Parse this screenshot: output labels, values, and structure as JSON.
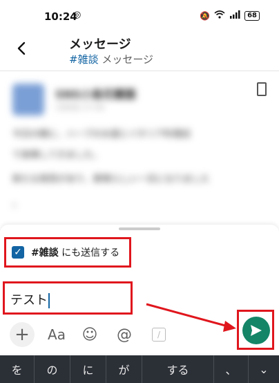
{
  "status_bar": {
    "time": "10:24",
    "battery": "68"
  },
  "header": {
    "title": "メッセージ",
    "channel": "#雑談",
    "subtitle_rest": " メッセージ"
  },
  "blurred_message": {
    "author": "SNS小島花蘭園",
    "date": "1月6日 17:44",
    "lines": [
      "今日の朝に、ハーブの水遣とイタリア料理店",
      "で食事してきました。",
      "新たな発見があり、素晴らしい一日になりました",
      "。"
    ]
  },
  "compose": {
    "also_send": {
      "channel": "#雑談",
      "rest": " にも送信する",
      "checked": true
    },
    "input_value": "テスト"
  },
  "toolbar": {
    "plus": "+",
    "format": "Aa",
    "emoji": "☺",
    "mention": "@",
    "slash": "/"
  },
  "keyboard": {
    "suggestions": [
      "を",
      "の",
      "に",
      "が",
      "する",
      "、"
    ],
    "expand": "⌄"
  },
  "colors": {
    "send": "#148567",
    "highlight": "#e0161d",
    "link": "#1264a3"
  }
}
